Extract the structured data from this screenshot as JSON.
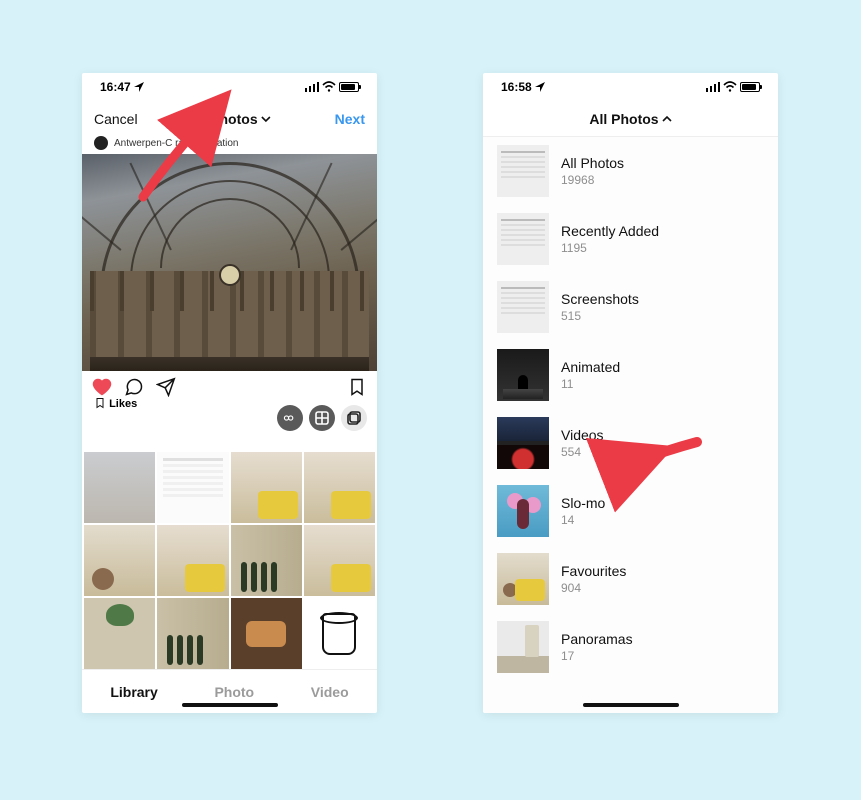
{
  "left": {
    "status": {
      "time": "16:47",
      "location_arrow": true
    },
    "nav": {
      "cancel": "Cancel",
      "title": "All Photos",
      "next": "Next"
    },
    "location_line": "Antwerpen-C          railway station",
    "likes_label": "Likes",
    "mode_buttons": [
      "infinity",
      "layout",
      "multi-select"
    ],
    "tabs": {
      "library": "Library",
      "photo": "Photo",
      "video": "Video",
      "active": "Library"
    }
  },
  "right": {
    "status": {
      "time": "16:58",
      "location_arrow": true
    },
    "nav": {
      "title": "All Photos"
    },
    "albums": [
      {
        "name": "All Photos",
        "count": "19968",
        "thumb": "doc"
      },
      {
        "name": "Recently Added",
        "count": "1195",
        "thumb": "doc"
      },
      {
        "name": "Screenshots",
        "count": "515",
        "thumb": "doc"
      },
      {
        "name": "Animated",
        "count": "11",
        "thumb": "night"
      },
      {
        "name": "Videos",
        "count": "554",
        "thumb": "vid"
      },
      {
        "name": "Slo-mo",
        "count": "14",
        "thumb": "slomo"
      },
      {
        "name": "Favourites",
        "count": "904",
        "thumb": "fav"
      },
      {
        "name": "Panoramas",
        "count": "17",
        "thumb": "pano"
      }
    ]
  },
  "annotations": {
    "arrow_left": {
      "points_to": "All Photos dropdown (left phone nav title)"
    },
    "arrow_right": {
      "points_to": "Videos album row"
    }
  },
  "colors": {
    "accent": "#3897f0",
    "heart": "#ed4956",
    "arrow": "#eb3b46"
  }
}
